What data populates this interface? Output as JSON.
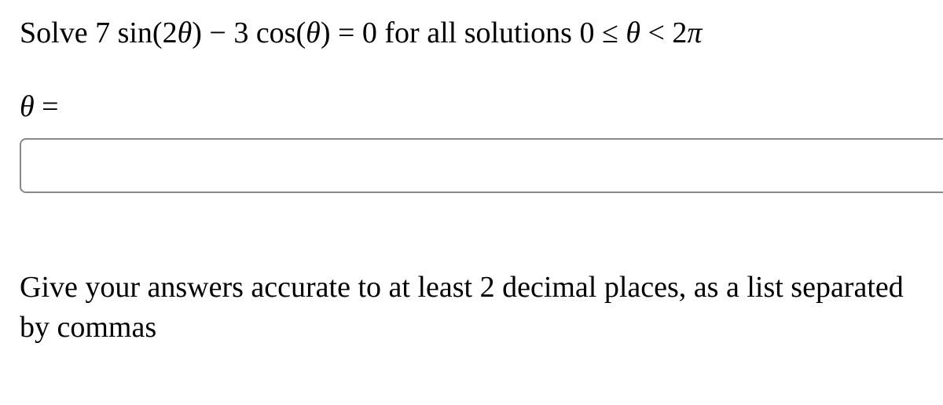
{
  "question": {
    "prefix": "Solve ",
    "equation_lhs_html": "7 sin(2<span class='italic'>θ</span>) − 3 cos(<span class='italic'>θ</span>) = 0",
    "middle": " for all solutions ",
    "range_html": "0 ≤ <span class='italic'>θ</span> < 2<span class='italic'>π</span>"
  },
  "answer": {
    "label_html": "<span class='italic'>θ</span> = ",
    "value": ""
  },
  "instruction": "Give your answers accurate to at least 2 decimal places, as a list separated by commas"
}
